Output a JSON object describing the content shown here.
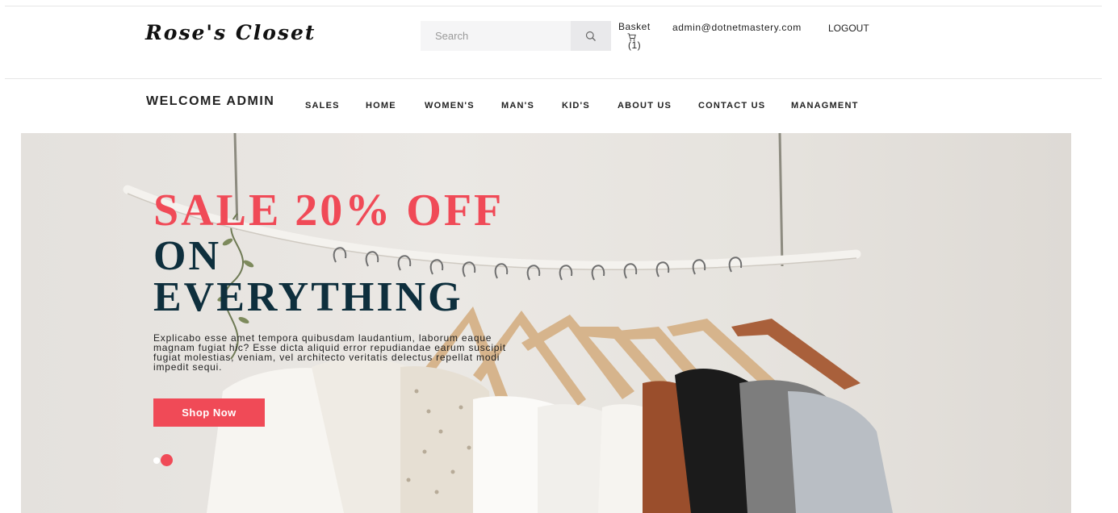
{
  "brand": {
    "logo_text": "Rose's Closet"
  },
  "search": {
    "placeholder": "Search",
    "icon": "search-icon"
  },
  "basket": {
    "label": "Basket",
    "count": "(1)",
    "icon": "cart-icon"
  },
  "user": {
    "email": "admin@dotnetmastery.com",
    "logout": "LOGOUT"
  },
  "nav": {
    "welcome": "WELCOME ADMIN",
    "items": [
      {
        "label": "SALES"
      },
      {
        "label": "HOME"
      },
      {
        "label": "WOMEN'S"
      },
      {
        "label": "MAN'S"
      },
      {
        "label": "KID'S"
      },
      {
        "label": "ABOUT US"
      },
      {
        "label": "CONTACT US"
      },
      {
        "label": "MANAGMENT"
      }
    ]
  },
  "hero": {
    "title_line1": "SALE 20% OFF",
    "title_line2": "ON",
    "title_line3": "EVERYTHING",
    "description": "Explicabo esse amet tempora quibusdam laudantium, laborum eaque magnam fugiat hic? Esse dicta aliquid error repudiandae earum suscipit fugiat molestias, veniam, vel architecto veritatis delectus repellat modi impedit sequi.",
    "button_label": "Shop Now",
    "slides_total": 2,
    "active_slide": 2
  },
  "colors": {
    "accent": "#f04a57",
    "title_dark": "#0e2f3d",
    "search_bg": "#f5f5f6"
  }
}
